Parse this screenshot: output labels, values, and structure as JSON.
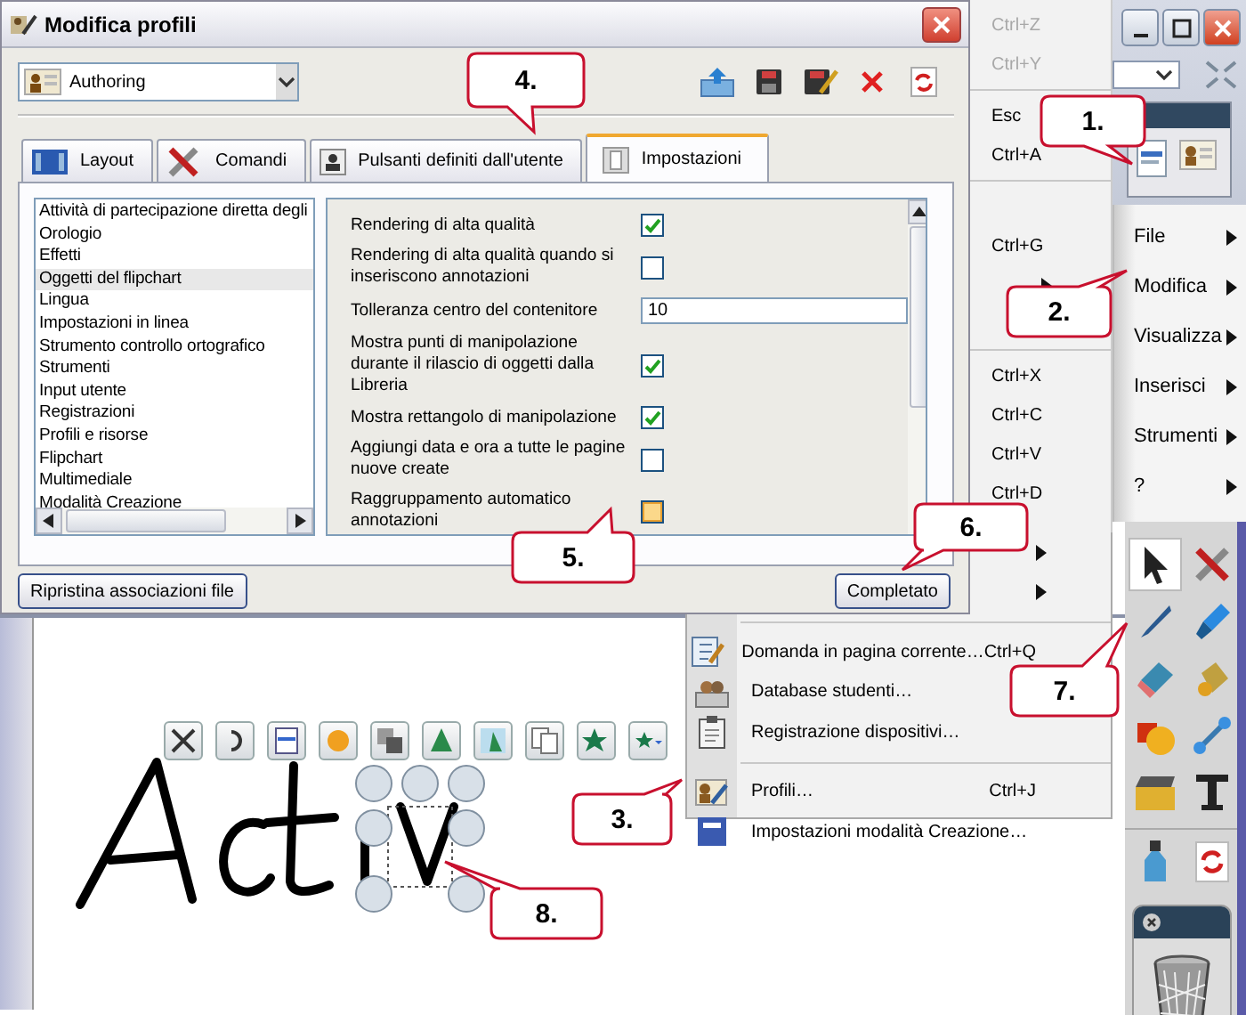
{
  "dialog": {
    "title": "Modifica profili",
    "profile": "Authoring",
    "tabs": [
      {
        "label": "Layout",
        "selected": false
      },
      {
        "label": "Comandi",
        "selected": false
      },
      {
        "label": "Pulsanti definiti dall'utente",
        "selected": false
      },
      {
        "label": "Impostazioni",
        "selected": true
      }
    ],
    "categories": [
      {
        "label": "Attività di partecipazione diretta degli",
        "selected": false
      },
      {
        "label": "Orologio",
        "selected": false
      },
      {
        "label": "Effetti",
        "selected": false
      },
      {
        "label": "Oggetti del flipchart",
        "selected": true
      },
      {
        "label": "Lingua",
        "selected": false
      },
      {
        "label": "Impostazioni in linea",
        "selected": false
      },
      {
        "label": "Strumento controllo ortografico",
        "selected": false
      },
      {
        "label": "Strumenti",
        "selected": false
      },
      {
        "label": "Input utente",
        "selected": false
      },
      {
        "label": "Registrazioni",
        "selected": false
      },
      {
        "label": "Profili e risorse",
        "selected": false
      },
      {
        "label": "Flipchart",
        "selected": false
      },
      {
        "label": "Multimediale",
        "selected": false
      },
      {
        "label": "Modalità Creazione",
        "selected": false
      }
    ],
    "settings": [
      {
        "kind": "checkbox",
        "label": "Rendering di alta qualità",
        "checked": true,
        "hovered": false
      },
      {
        "kind": "checkbox",
        "label": "Rendering di alta qualità quando si inseriscono annotazioni",
        "checked": false,
        "hovered": false
      },
      {
        "kind": "text",
        "label": "Tolleranza centro del contenitore",
        "value": "10"
      },
      {
        "kind": "checkbox",
        "label": "Mostra punti di manipolazione durante il rilascio di oggetti dalla Libreria",
        "checked": true,
        "hovered": false
      },
      {
        "kind": "checkbox",
        "label": "Mostra rettangolo di manipolazione",
        "checked": true,
        "hovered": false
      },
      {
        "kind": "checkbox",
        "label": "Aggiungi data e ora a tutte le pagine nuove create",
        "checked": false,
        "hovered": false
      },
      {
        "kind": "checkbox",
        "label": "Raggruppamento automatico annotazioni",
        "checked": false,
        "hovered": true
      }
    ],
    "buttons": [
      "Ripristina associazioni file",
      "Completato"
    ]
  },
  "edit_menu": [
    {
      "kind": "shortcut",
      "text": "Ctrl+Z",
      "disabled": true
    },
    {
      "kind": "shortcut",
      "text": "Ctrl+Y",
      "disabled": true
    },
    {
      "kind": "separator"
    },
    {
      "kind": "shortcut",
      "text": "Esc",
      "disabled": false
    },
    {
      "kind": "shortcut",
      "text": "Ctrl+A",
      "disabled": false
    },
    {
      "kind": "separator"
    },
    {
      "kind": "blank"
    },
    {
      "kind": "shortcut",
      "text": "Ctrl+G",
      "disabled": false
    },
    {
      "kind": "submenu"
    },
    {
      "kind": "blank"
    },
    {
      "kind": "separator"
    },
    {
      "kind": "shortcut",
      "text": "Ctrl+X",
      "disabled": false
    },
    {
      "kind": "shortcut",
      "text": "Ctrl+C",
      "disabled": false
    },
    {
      "kind": "shortcut",
      "text": "Ctrl+V",
      "disabled": false
    },
    {
      "kind": "shortcut",
      "text": "Ctrl+D",
      "disabled": false
    }
  ],
  "tools_menu": [
    {
      "kind": "submenu"
    },
    {
      "kind": "submenu"
    },
    {
      "kind": "separator"
    },
    {
      "kind": "item",
      "label": "Domanda in pagina corrente…",
      "shortcut": "Ctrl+Q"
    },
    {
      "kind": "item",
      "label": "Database studenti…"
    },
    {
      "kind": "item",
      "label": "Registrazione dispositivi…"
    },
    {
      "kind": "separator"
    },
    {
      "kind": "item",
      "label": "Profili…",
      "shortcut": "Ctrl+J"
    },
    {
      "kind": "item",
      "label": "Impostazioni modalità Creazione…"
    }
  ],
  "main_menu": [
    {
      "label": "File",
      "submenu": true
    },
    {
      "label": "Modifica",
      "submenu": true
    },
    {
      "label": "Visualizza",
      "submenu": true
    },
    {
      "label": "Inserisci",
      "submenu": true
    },
    {
      "label": "Strumenti",
      "submenu": true
    },
    {
      "label": "?",
      "submenu": true
    }
  ],
  "callouts": [
    "1.",
    "2.",
    "3.",
    "4.",
    "5.",
    "6.",
    "7.",
    "8."
  ]
}
